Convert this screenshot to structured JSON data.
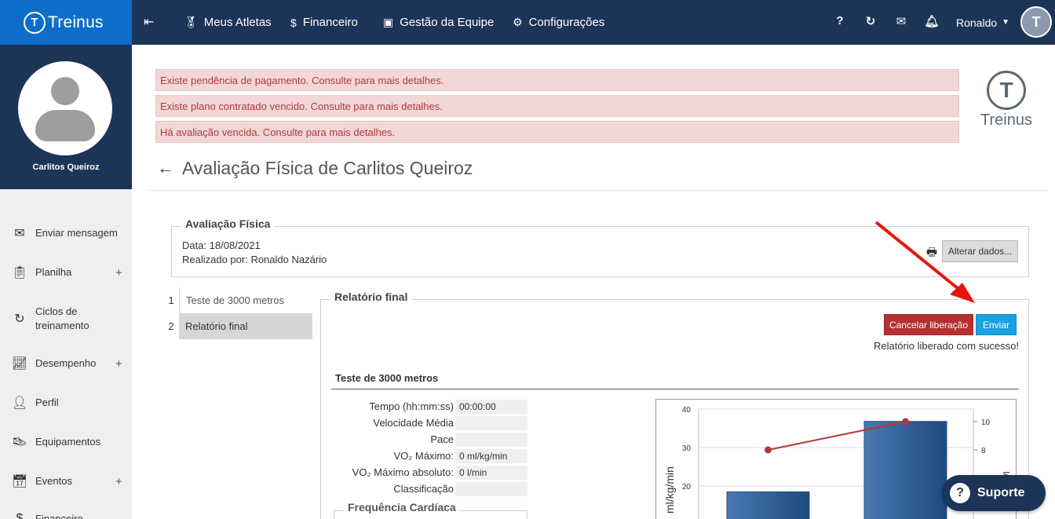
{
  "topbar": {
    "brand": "Treinus",
    "nav": [
      {
        "label": "Meus Atletas",
        "icon": "medal-icon"
      },
      {
        "label": "Financeiro",
        "icon": "dollar-icon"
      },
      {
        "label": "Gestão da Equipe",
        "icon": "id-card-icon"
      },
      {
        "label": "Configurações",
        "icon": "gears-icon"
      }
    ],
    "user_name": "Ronaldo"
  },
  "sidebar": {
    "athlete_name": "Carlitos Queiroz",
    "items": [
      {
        "label": "Enviar mensagem",
        "icon": "envelope-icon",
        "has_plus": false
      },
      {
        "label": "Planilha",
        "icon": "clipboard-icon",
        "has_plus": true
      },
      {
        "label": "Ciclos de treinamento",
        "icon": "refresh-icon",
        "has_plus": false
      },
      {
        "label": "Desempenho",
        "icon": "chart-line-icon",
        "has_plus": true
      },
      {
        "label": "Perfil",
        "icon": "user-icon",
        "has_plus": false
      },
      {
        "label": "Equipamentos",
        "icon": "shoe-icon",
        "has_plus": false
      },
      {
        "label": "Eventos",
        "icon": "calendar-icon",
        "has_plus": true
      },
      {
        "label": "Financeiro",
        "icon": "money-icon",
        "has_plus": false
      }
    ]
  },
  "alerts": [
    "Existe pendência de pagamento. Consulte para mais detalhes.",
    "Existe plano contratado vencido. Consulte para mais detalhes.",
    "Há avaliação vencida. Consulte para mais detalhes."
  ],
  "logo_word": "Treinus",
  "page_title": "Avaliação Física de Carlitos Queiroz",
  "evaluation": {
    "legend": "Avaliação Física",
    "date_line": "Data: 18/08/2021",
    "performed_by_line": "Realizado por: Ronaldo Nazário",
    "alter_button": "Alterar dados..."
  },
  "steps": [
    {
      "num": "1",
      "label": "Teste de 3000 metros",
      "active": false
    },
    {
      "num": "2",
      "label": "Relatório final",
      "active": true
    }
  ],
  "report": {
    "legend": "Relatório final",
    "cancel_button": "Cancelar liberação",
    "send_button": "Enviar",
    "success_message": "Relatório liberado com sucesso!",
    "section_title": "Teste de 3000 metros",
    "fields": [
      {
        "label": "Tempo (hh:mm:ss)",
        "value": "00:00:00"
      },
      {
        "label": "Velocidade Média",
        "value": ""
      },
      {
        "label": "Pace",
        "value": ""
      },
      {
        "label": "VO₂ Máximo:",
        "value": "0 ml/kg/min"
      },
      {
        "label": "VO₂ Máximo absoluto:",
        "value": "0 l/min"
      },
      {
        "label": "Classificação",
        "value": ""
      }
    ],
    "heart_rate_legend": "Frequência Cardíaca"
  },
  "chart_data": {
    "type": "bar",
    "ylabel": "ml/kg/min",
    "y_ticks": [
      20,
      30,
      40
    ],
    "y2_ticks": [
      8,
      10
    ],
    "bars": [
      18.5,
      36.8
    ],
    "line": [
      8.0,
      10.0
    ],
    "y2_label": "l/min"
  },
  "support_button": "Suporte",
  "colors": {
    "topbar": "#1c3458",
    "brand": "#0d6ec9",
    "alert_bg": "#f2d7d7",
    "alert_text": "#b03a3a",
    "cancel": "#b5302f",
    "send": "#1ba1e2",
    "bar": "#2f5d93",
    "line": "#b33a3a"
  }
}
